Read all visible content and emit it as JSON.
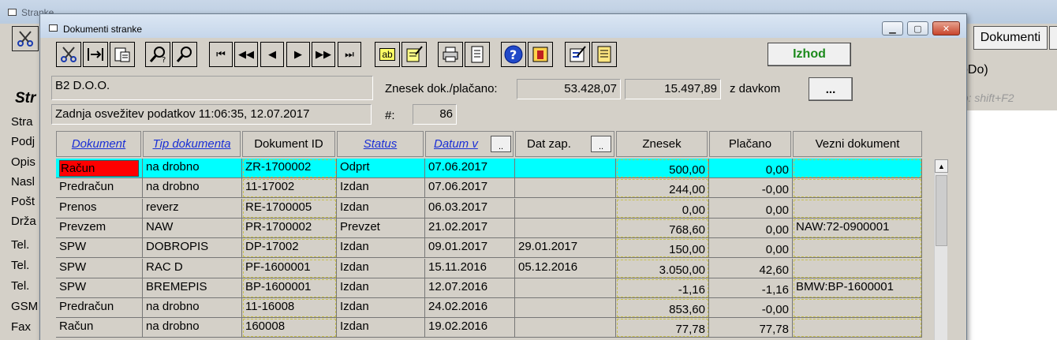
{
  "background": {
    "title": "Stranke",
    "dokumenti_button": "Dokumenti",
    "todo_label": "oDo)",
    "hint": "nb: shift+F2",
    "heading": "Str",
    "fields": [
      "Stra",
      "Podj",
      "Opis",
      "Nasl",
      "Pošt",
      "Drža",
      "Tel.",
      "Tel.",
      "Tel.",
      "GSM",
      "Fax"
    ]
  },
  "dialog": {
    "title": "Dokumenti stranke",
    "izhod_label": "Izhod",
    "company": "B2 D.O.O.",
    "refresh_label": "Zadnja osvežitev podatkov 11:06:35, 12.07.2017",
    "znesek_label": "Znesek dok./plačano:",
    "znesek_value": "53.428,07",
    "placano_value": "15.497,89",
    "davek_label": "z davkom",
    "ellipsis_label": "...",
    "count_label": "#:",
    "count_value": "86"
  },
  "toolbar": {
    "text_btn1": "ab",
    "icons": [
      "scissors-icon",
      "merge-icon",
      "paste-icon",
      "search-help-icon",
      "search-icon",
      "first-record-icon",
      "rewind-icon",
      "prev-icon",
      "next-icon",
      "fast-forward-icon",
      "last-record-icon",
      "text-icon",
      "edit-note-icon",
      "print-icon",
      "document-icon",
      "help-icon",
      "calendar-icon",
      "edit-form-icon",
      "list-icon"
    ]
  },
  "table": {
    "columns": {
      "dokument": "Dokument",
      "tip": "Tip dokumenta",
      "dokument_id": "Dokument ID",
      "status": "Status",
      "datum": "Datum v",
      "dat_zap": "Dat zap.",
      "znesek": "Znesek",
      "placano": "Plačano",
      "vezni": "Vezni dokument",
      "sort_btn": ".."
    },
    "rows": [
      {
        "dokument": "Račun",
        "tip": "na drobno",
        "id": "ZR-1700002",
        "status": "Odprt",
        "datum": "07.06.2017",
        "dat_zap": "",
        "znesek": "500,00",
        "placano": "0,00",
        "vezni": ""
      },
      {
        "dokument": "Predračun",
        "tip": "na drobno",
        "id": "11-17002",
        "status": "Izdan",
        "datum": "07.06.2017",
        "dat_zap": "",
        "znesek": "244,00",
        "placano": "-0,00",
        "vezni": ""
      },
      {
        "dokument": "Prenos",
        "tip": "reverz",
        "id": "RE-1700005",
        "status": "Izdan",
        "datum": "06.03.2017",
        "dat_zap": "",
        "znesek": "0,00",
        "placano": "0,00",
        "vezni": ""
      },
      {
        "dokument": "Prevzem",
        "tip": "NAW",
        "id": "PR-1700002",
        "status": "Prevzet",
        "datum": "21.02.2017",
        "dat_zap": "",
        "znesek": "768,60",
        "placano": "0,00",
        "vezni": "NAW:72-0900001"
      },
      {
        "dokument": "SPW",
        "tip": "DOBROPIS",
        "id": "DP-17002",
        "status": "Izdan",
        "datum": "09.01.2017",
        "dat_zap": "29.01.2017",
        "znesek": "150,00",
        "placano": "0,00",
        "vezni": ""
      },
      {
        "dokument": "SPW",
        "tip": "RAC D",
        "id": "PF-1600001",
        "status": "Izdan",
        "datum": "15.11.2016",
        "dat_zap": "05.12.2016",
        "znesek": "3.050,00",
        "placano": "42,60",
        "vezni": ""
      },
      {
        "dokument": "SPW",
        "tip": "BREMEPIS",
        "id": "BP-1600001",
        "status": "Izdan",
        "datum": "12.07.2016",
        "dat_zap": "",
        "znesek": "-1,16",
        "placano": "-1,16",
        "vezni": "BMW:BP-1600001"
      },
      {
        "dokument": "Predračun",
        "tip": "na drobno",
        "id": "11-16008",
        "status": "Izdan",
        "datum": "24.02.2016",
        "dat_zap": "",
        "znesek": "853,60",
        "placano": "-0,00",
        "vezni": ""
      },
      {
        "dokument": "Račun",
        "tip": "na drobno",
        "id": "160008",
        "status": "Izdan",
        "datum": "19.02.2016",
        "dat_zap": "",
        "znesek": "77,78",
        "placano": "77,78",
        "vezni": ""
      }
    ]
  },
  "colors": {
    "selected_row": "#00ffff",
    "selected_cell": "#ff0000",
    "link": "#1a2fd6",
    "izhod": "#1c8a1c"
  }
}
